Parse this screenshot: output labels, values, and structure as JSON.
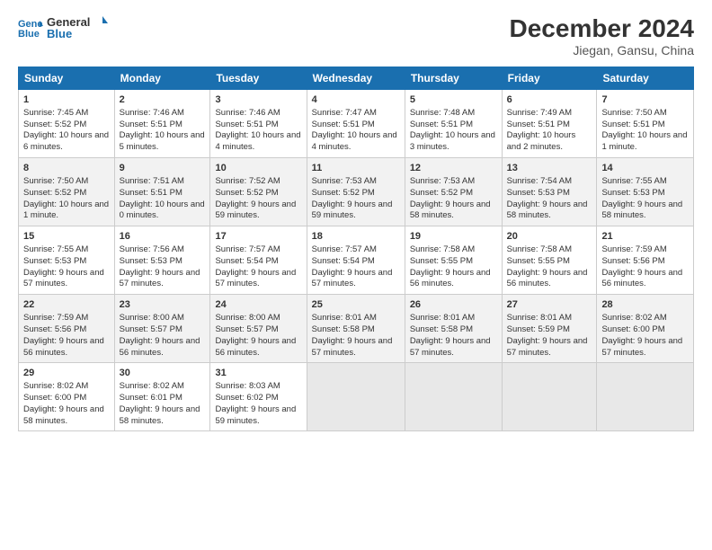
{
  "logo": {
    "line1": "General",
    "line2": "Blue"
  },
  "title": "December 2024",
  "subtitle": "Jiegan, Gansu, China",
  "weekdays": [
    "Sunday",
    "Monday",
    "Tuesday",
    "Wednesday",
    "Thursday",
    "Friday",
    "Saturday"
  ],
  "weeks": [
    [
      {
        "day": 1,
        "sunrise": "7:45 AM",
        "sunset": "5:52 PM",
        "daylight": "10 hours and 6 minutes."
      },
      {
        "day": 2,
        "sunrise": "7:46 AM",
        "sunset": "5:51 PM",
        "daylight": "10 hours and 5 minutes."
      },
      {
        "day": 3,
        "sunrise": "7:46 AM",
        "sunset": "5:51 PM",
        "daylight": "10 hours and 4 minutes."
      },
      {
        "day": 4,
        "sunrise": "7:47 AM",
        "sunset": "5:51 PM",
        "daylight": "10 hours and 4 minutes."
      },
      {
        "day": 5,
        "sunrise": "7:48 AM",
        "sunset": "5:51 PM",
        "daylight": "10 hours and 3 minutes."
      },
      {
        "day": 6,
        "sunrise": "7:49 AM",
        "sunset": "5:51 PM",
        "daylight": "10 hours and 2 minutes."
      },
      {
        "day": 7,
        "sunrise": "7:50 AM",
        "sunset": "5:51 PM",
        "daylight": "10 hours and 1 minute."
      }
    ],
    [
      {
        "day": 8,
        "sunrise": "7:50 AM",
        "sunset": "5:52 PM",
        "daylight": "10 hours and 1 minute."
      },
      {
        "day": 9,
        "sunrise": "7:51 AM",
        "sunset": "5:51 PM",
        "daylight": "10 hours and 0 minutes."
      },
      {
        "day": 10,
        "sunrise": "7:52 AM",
        "sunset": "5:52 PM",
        "daylight": "9 hours and 59 minutes."
      },
      {
        "day": 11,
        "sunrise": "7:53 AM",
        "sunset": "5:52 PM",
        "daylight": "9 hours and 59 minutes."
      },
      {
        "day": 12,
        "sunrise": "7:53 AM",
        "sunset": "5:52 PM",
        "daylight": "9 hours and 58 minutes."
      },
      {
        "day": 13,
        "sunrise": "7:54 AM",
        "sunset": "5:53 PM",
        "daylight": "9 hours and 58 minutes."
      },
      {
        "day": 14,
        "sunrise": "7:55 AM",
        "sunset": "5:53 PM",
        "daylight": "9 hours and 58 minutes."
      }
    ],
    [
      {
        "day": 15,
        "sunrise": "7:55 AM",
        "sunset": "5:53 PM",
        "daylight": "9 hours and 57 minutes."
      },
      {
        "day": 16,
        "sunrise": "7:56 AM",
        "sunset": "5:53 PM",
        "daylight": "9 hours and 57 minutes."
      },
      {
        "day": 17,
        "sunrise": "7:57 AM",
        "sunset": "5:54 PM",
        "daylight": "9 hours and 57 minutes."
      },
      {
        "day": 18,
        "sunrise": "7:57 AM",
        "sunset": "5:54 PM",
        "daylight": "9 hours and 57 minutes."
      },
      {
        "day": 19,
        "sunrise": "7:58 AM",
        "sunset": "5:55 PM",
        "daylight": "9 hours and 56 minutes."
      },
      {
        "day": 20,
        "sunrise": "7:58 AM",
        "sunset": "5:55 PM",
        "daylight": "9 hours and 56 minutes."
      },
      {
        "day": 21,
        "sunrise": "7:59 AM",
        "sunset": "5:56 PM",
        "daylight": "9 hours and 56 minutes."
      }
    ],
    [
      {
        "day": 22,
        "sunrise": "7:59 AM",
        "sunset": "5:56 PM",
        "daylight": "9 hours and 56 minutes."
      },
      {
        "day": 23,
        "sunrise": "8:00 AM",
        "sunset": "5:57 PM",
        "daylight": "9 hours and 56 minutes."
      },
      {
        "day": 24,
        "sunrise": "8:00 AM",
        "sunset": "5:57 PM",
        "daylight": "9 hours and 56 minutes."
      },
      {
        "day": 25,
        "sunrise": "8:01 AM",
        "sunset": "5:58 PM",
        "daylight": "9 hours and 57 minutes."
      },
      {
        "day": 26,
        "sunrise": "8:01 AM",
        "sunset": "5:58 PM",
        "daylight": "9 hours and 57 minutes."
      },
      {
        "day": 27,
        "sunrise": "8:01 AM",
        "sunset": "5:59 PM",
        "daylight": "9 hours and 57 minutes."
      },
      {
        "day": 28,
        "sunrise": "8:02 AM",
        "sunset": "6:00 PM",
        "daylight": "9 hours and 57 minutes."
      }
    ],
    [
      {
        "day": 29,
        "sunrise": "8:02 AM",
        "sunset": "6:00 PM",
        "daylight": "9 hours and 58 minutes."
      },
      {
        "day": 30,
        "sunrise": "8:02 AM",
        "sunset": "6:01 PM",
        "daylight": "9 hours and 58 minutes."
      },
      {
        "day": 31,
        "sunrise": "8:03 AM",
        "sunset": "6:02 PM",
        "daylight": "9 hours and 59 minutes."
      },
      null,
      null,
      null,
      null
    ]
  ]
}
